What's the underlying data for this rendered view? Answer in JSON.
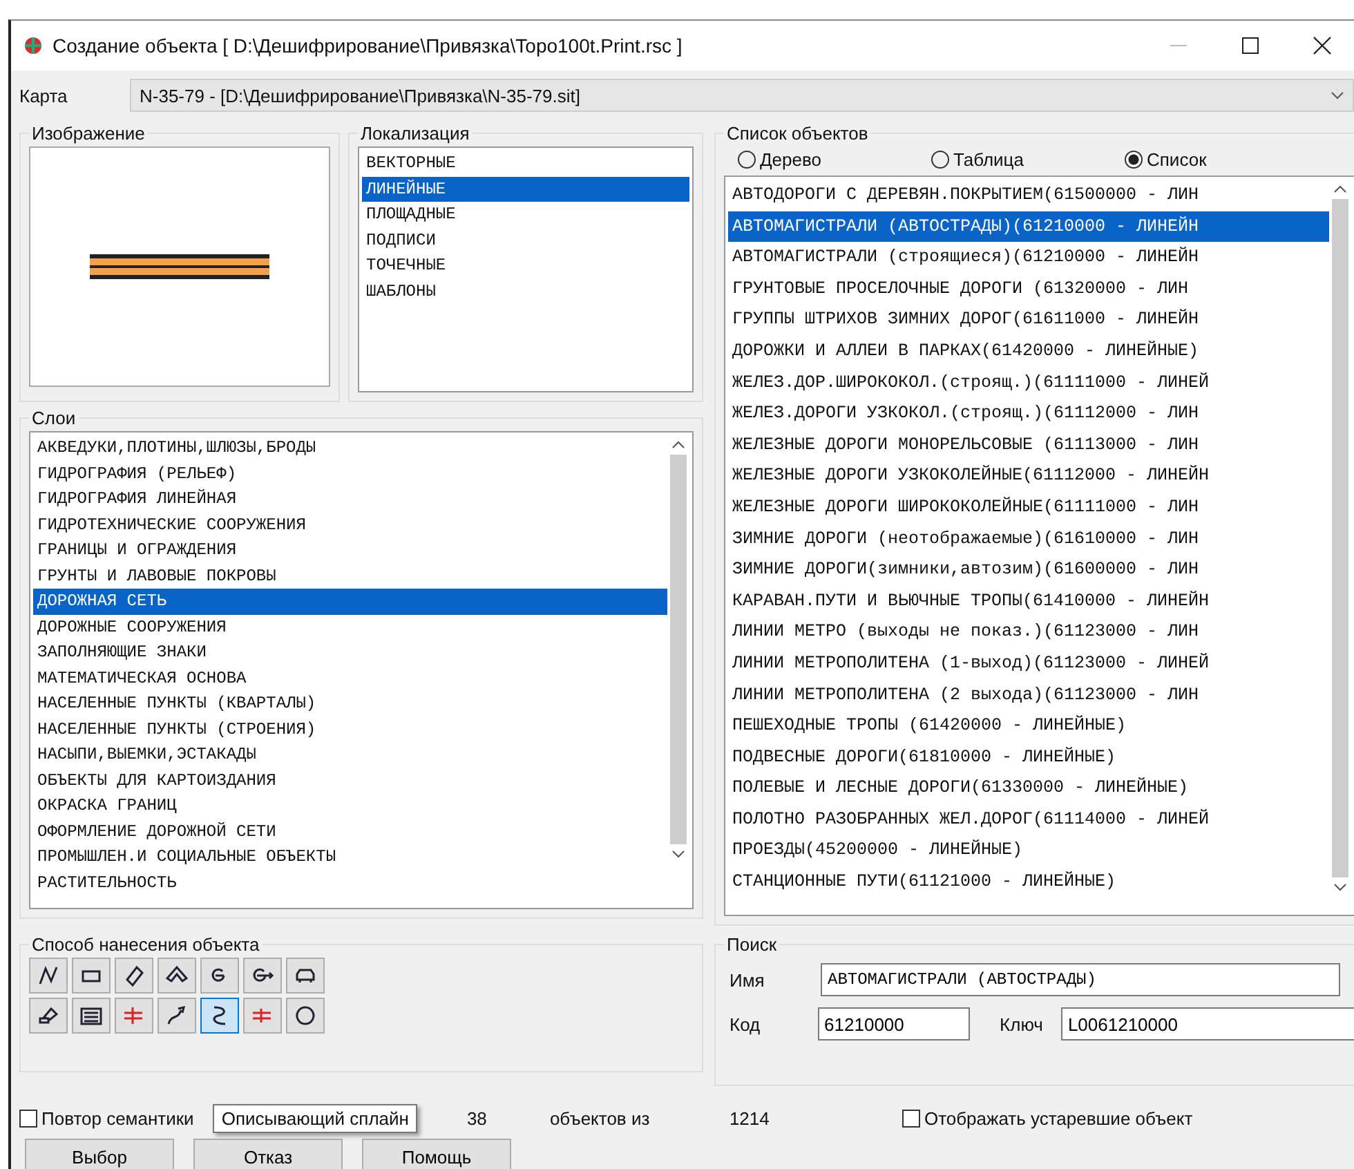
{
  "window": {
    "title": "Создание объекта  [ D:\\Дешифрирование\\Привязка\\Topo100t.Print.rsc ]"
  },
  "map": {
    "label": "Карта",
    "value": "N-35-79 - [D:\\Дешифрирование\\Привязка\\N-35-79.sit]"
  },
  "image_group": {
    "title": "Изображение"
  },
  "localization": {
    "title": "Локализация",
    "items": [
      {
        "label": "ВЕКТОРНЫЕ",
        "selected": false
      },
      {
        "label": "ЛИНЕЙНЫЕ",
        "selected": true
      },
      {
        "label": "ПЛОЩАДНЫЕ",
        "selected": false
      },
      {
        "label": "ПОДПИСИ",
        "selected": false
      },
      {
        "label": "ТОЧЕЧНЫЕ",
        "selected": false
      },
      {
        "label": "ШАБЛОНЫ",
        "selected": false
      }
    ]
  },
  "layers": {
    "title": "Слои",
    "items": [
      {
        "label": "АКВЕДУКИ,ПЛОТИНЫ,ШЛЮЗЫ,БРОДЫ",
        "selected": false
      },
      {
        "label": "ГИДРОГРАФИЯ (РЕЛЬЕФ)",
        "selected": false
      },
      {
        "label": "ГИДРОГРАФИЯ ЛИНЕЙНАЯ",
        "selected": false
      },
      {
        "label": "ГИДРОТЕХНИЧЕСКИЕ СООРУЖЕНИЯ",
        "selected": false
      },
      {
        "label": "ГРАНИЦЫ И ОГРАЖДЕНИЯ",
        "selected": false
      },
      {
        "label": "ГРУНТЫ И ЛАВОВЫЕ ПОКРОВЫ",
        "selected": false
      },
      {
        "label": "ДОРОЖНАЯ СЕТЬ",
        "selected": true
      },
      {
        "label": "ДОРОЖНЫЕ СООРУЖЕНИЯ",
        "selected": false
      },
      {
        "label": "ЗАПОЛНЯЮЩИЕ ЗНАКИ",
        "selected": false
      },
      {
        "label": "МАТЕМАТИЧЕСКАЯ ОСНОВА",
        "selected": false
      },
      {
        "label": "НАСЕЛЕННЫЕ ПУНКТЫ (КВАРТАЛЫ)",
        "selected": false
      },
      {
        "label": "НАСЕЛЕННЫЕ ПУНКТЫ (СТРОЕНИЯ)",
        "selected": false
      },
      {
        "label": "НАСЫПИ,ВЫЕМКИ,ЭСТАКАДЫ",
        "selected": false
      },
      {
        "label": "ОБЪЕКТЫ ДЛЯ КАРТОИЗДАНИЯ",
        "selected": false
      },
      {
        "label": "ОКРАСКА ГРАНИЦ",
        "selected": false
      },
      {
        "label": "ОФОРМЛЕНИЕ ДОРОЖНОЙ СЕТИ",
        "selected": false
      },
      {
        "label": "ПРОМЫШЛЕН.И СОЦИАЛЬНЫЕ ОБЪЕКТЫ",
        "selected": false
      },
      {
        "label": "РАСТИТЕЛЬНОСТЬ",
        "selected": false
      }
    ]
  },
  "object_list": {
    "title": "Список объектов",
    "view_options": [
      {
        "label": "Дерево",
        "selected": false
      },
      {
        "label": "Таблица",
        "selected": false
      },
      {
        "label": "Список",
        "selected": true
      }
    ],
    "items": [
      {
        "label": "АВТОДОРОГИ С ДЕРЕВЯН.ПОКРЫТИЕМ(61500000 - ЛИН",
        "selected": false
      },
      {
        "label": "АВТОМАГИСТРАЛИ (АВТОСТРАДЫ)(61210000 - ЛИНЕЙН",
        "selected": true
      },
      {
        "label": "АВТОМАГИСТРАЛИ (строящиеся)(61210000 - ЛИНЕЙН",
        "selected": false
      },
      {
        "label": "ГРУНТОВЫЕ ПРОСЕЛОЧНЫЕ ДОРОГИ  (61320000 - ЛИН",
        "selected": false
      },
      {
        "label": "ГРУППЫ ШТРИХОВ ЗИМНИХ ДОРОГ(61611000 - ЛИНЕЙН",
        "selected": false
      },
      {
        "label": "ДОРОЖКИ И АЛЛЕИ В ПАРКАХ(61420000 - ЛИНЕЙНЫЕ)",
        "selected": false
      },
      {
        "label": "ЖЕЛЕЗ.ДОР.ШИРОКОКОЛ.(строящ.)(61111000 - ЛИНЕЙ",
        "selected": false
      },
      {
        "label": "ЖЕЛЕЗ.ДОРОГИ УЗКОКОЛ.(строящ.)(61112000 - ЛИН",
        "selected": false
      },
      {
        "label": "ЖЕЛЕЗНЫЕ ДОРОГИ МОНОРЕЛЬСОВЫЕ (61113000 - ЛИН",
        "selected": false
      },
      {
        "label": "ЖЕЛЕЗНЫЕ ДОРОГИ УЗКОКОЛЕЙНЫЕ(61112000 - ЛИНЕЙН",
        "selected": false
      },
      {
        "label": "ЖЕЛЕЗНЫЕ ДОРОГИ ШИРОКОКОЛЕЙНЫЕ(61111000 - ЛИН",
        "selected": false
      },
      {
        "label": "ЗИМНИЕ ДОРОГИ (неотображаемые)(61610000 - ЛИН",
        "selected": false
      },
      {
        "label": "ЗИМНИЕ ДОРОГИ(зимники,автозим)(61600000 - ЛИН",
        "selected": false
      },
      {
        "label": "КАРАВАН.ПУТИ И ВЬЮЧНЫЕ ТРОПЫ(61410000 - ЛИНЕЙН",
        "selected": false
      },
      {
        "label": "ЛИНИИ МЕТРО (выходы не показ.)(61123000 - ЛИН",
        "selected": false
      },
      {
        "label": "ЛИНИИ МЕТРОПОЛИТЕНА (1-выход)(61123000 - ЛИНЕЙ",
        "selected": false
      },
      {
        "label": "ЛИНИИ МЕТРОПОЛИТЕНА (2 выхода)(61123000 - ЛИН",
        "selected": false
      },
      {
        "label": "ПЕШЕХОДНЫЕ ТРОПЫ (61420000 - ЛИНЕЙНЫЕ)",
        "selected": false
      },
      {
        "label": "ПОДВЕСНЫЕ ДОРОГИ(61810000 - ЛИНЕЙНЫЕ)",
        "selected": false
      },
      {
        "label": "ПОЛЕВЫЕ И ЛЕСНЫЕ ДОРОГИ(61330000 - ЛИНЕЙНЫЕ)",
        "selected": false
      },
      {
        "label": "ПОЛОТНО РАЗОБРАННЫХ ЖЕЛ.ДОРОГ(61114000 - ЛИНЕЙ",
        "selected": false
      },
      {
        "label": "ПРОЕЗДЫ(45200000 - ЛИНЕЙНЫЕ)",
        "selected": false
      },
      {
        "label": "СТАНЦИОННЫЕ ПУТИ(61121000 - ЛИНЕЙНЫЕ)",
        "selected": false
      }
    ]
  },
  "method": {
    "title": "Способ нанесения объекта",
    "tools": [
      {
        "selected": false
      },
      {
        "selected": false
      },
      {
        "selected": false
      },
      {
        "selected": false
      },
      {
        "selected": false
      },
      {
        "selected": false
      },
      {
        "selected": false
      },
      {
        "selected": false
      },
      {
        "selected": false
      },
      {
        "selected": false
      },
      {
        "selected": false
      },
      {
        "selected": true
      },
      {
        "selected": false
      },
      {
        "selected": false
      }
    ],
    "tooltip": "Описывающий сплайн"
  },
  "search": {
    "title": "Поиск",
    "name_label": "Имя",
    "name_value": "АВТОМАГИСТРАЛИ (АВТОСТРАДЫ)",
    "code_label": "Код",
    "code_value": "61210000",
    "key_label": "Ключ",
    "key_value": "L0061210000"
  },
  "repeat_semantics": {
    "label": "Повтор семантики",
    "checked": false
  },
  "count": {
    "shown": "38",
    "middle": "объектов из",
    "total": "1214"
  },
  "show_obsolete": {
    "label": "Отображать устаревшие объект",
    "checked": false
  },
  "buttons": [
    "Выбор",
    "Отказ",
    "Помощь"
  ]
}
